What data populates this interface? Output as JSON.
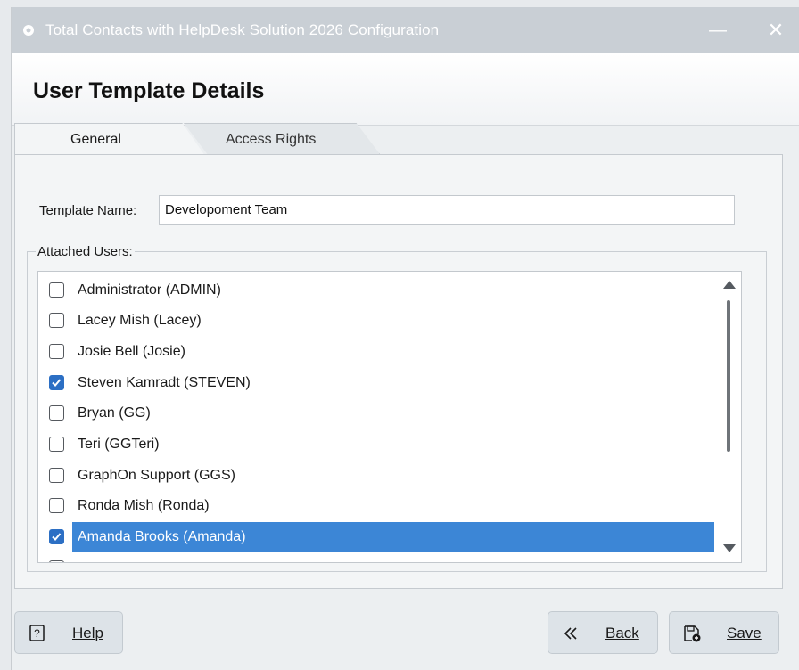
{
  "window": {
    "title": "Total Contacts with HelpDesk Solution 2026 Configuration",
    "minimize_glyph": "—",
    "close_glyph": "✕"
  },
  "page_title": "User Template Details",
  "tabs": [
    {
      "label": "General",
      "active": true
    },
    {
      "label": "Access Rights",
      "active": false
    }
  ],
  "form": {
    "template_name_label": "Template Name:",
    "template_name_value": "Developoment Team",
    "attached_users_label": "Attached Users:"
  },
  "users": [
    {
      "label": "Administrator (ADMIN)",
      "checked": false
    },
    {
      "label": "Lacey Mish (Lacey)",
      "checked": false
    },
    {
      "label": "Josie Bell (Josie)",
      "checked": false
    },
    {
      "label": "Steven Kamradt (STEVEN)",
      "checked": true
    },
    {
      "label": "Bryan (GG)",
      "checked": false
    },
    {
      "label": "Teri (GGTeri)",
      "checked": false
    },
    {
      "label": "GraphOn Support (GGS)",
      "checked": false
    },
    {
      "label": "Ronda Mish (Ronda)",
      "checked": false
    },
    {
      "label": "Amanda Brooks (Amanda)",
      "checked": true,
      "selected": true
    }
  ],
  "buttons": {
    "help": "Help",
    "back": "Back",
    "save": "Save"
  },
  "colors": {
    "selection": "#3c86d6",
    "checkbox_checked": "#2c6fc4",
    "titlebar": "#c9cfd5"
  }
}
